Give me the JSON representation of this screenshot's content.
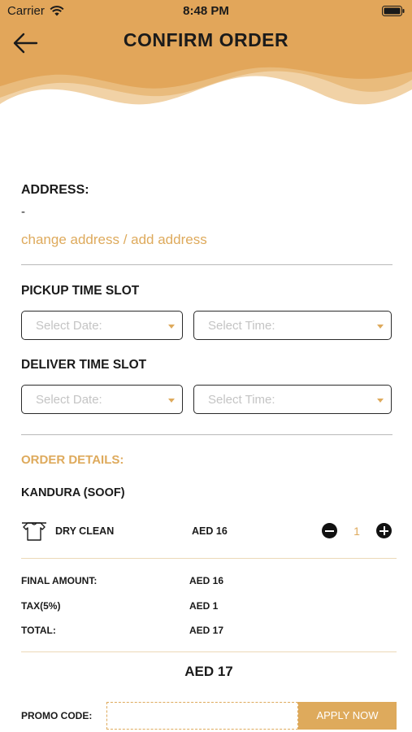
{
  "status_bar": {
    "carrier": "Carrier",
    "time": "8:48 PM"
  },
  "header": {
    "title": "CONFIRM ORDER",
    "back_icon": "arrow-left-icon"
  },
  "colors": {
    "accent": "#deaa5c",
    "header_wave": "#e2a65a",
    "text": "#1a1a1a"
  },
  "address": {
    "label": "ADDRESS:",
    "value": "-",
    "change_link": "change address / add address"
  },
  "pickup": {
    "label": "PICKUP TIME SLOT",
    "date_placeholder": "Select Date:",
    "time_placeholder": "Select Time:"
  },
  "deliver": {
    "label": "DELIVER TIME SLOT",
    "date_placeholder": "Select Date:",
    "time_placeholder": "Select Time:"
  },
  "order": {
    "label": "ORDER DETAILS:",
    "item_name": "KANDURA (SOOF)",
    "lines": [
      {
        "service": "DRY CLEAN",
        "price": "AED 16",
        "quantity": "1",
        "icon": "shirt-on-hanger-icon"
      }
    ]
  },
  "summary": {
    "final_label": "FINAL AMOUNT:",
    "final_value": "AED 16",
    "tax_label": "TAX(5%)",
    "tax_value": "AED 1",
    "total_label": "TOTAL:",
    "total_value": "AED 17",
    "grand_total": "AED 17"
  },
  "promo": {
    "label": "PROMO CODE:",
    "value": "",
    "apply_label": "APPLY NOW"
  }
}
